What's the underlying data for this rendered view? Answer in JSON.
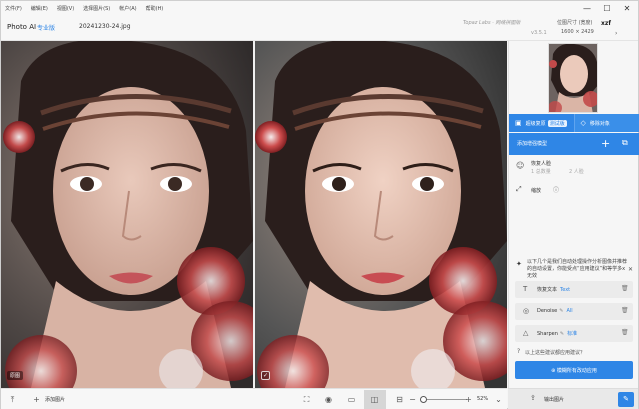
{
  "menu": [
    "文件(F)",
    "编辑(E)",
    "视图(V)",
    "选择图片(S)",
    "帐户(A)",
    "帮助(H)"
  ],
  "window_controls": {
    "minimize": "—",
    "maximize": "☐",
    "close": "✕"
  },
  "header": {
    "app_name": "Photo AI",
    "edition": "专业版",
    "file_name": "20241230-24.jpg",
    "brand": "Topaz Labs · 网络拼图版",
    "version": "v3.5.1",
    "output_size_label": "位图尺寸 (宽度)",
    "output_size": "1600 × 2429",
    "user": "xzf",
    "arrow": "›"
  },
  "preview": {
    "original_badge": "原图",
    "check_mark": "✓"
  },
  "bottombar": {
    "upload_icon": "⤒",
    "add_icon": "+",
    "add_image_label": "添加图片",
    "zoom_value": "52%",
    "zoom_chevron": "⌄",
    "crop_icon": "⛶",
    "eye_icon": "◉",
    "single_icon": "▭",
    "compare_icon": "◫",
    "split_icon": "⊟",
    "minus_icon": "−",
    "plus_icon": "+"
  },
  "panel": {
    "tabs": [
      {
        "icon": "▣",
        "label": "超级复原",
        "pill": "测试版"
      },
      {
        "icon": "◇",
        "label": "移除对象"
      }
    ],
    "add_model": {
      "label": "添加增强模型",
      "plus": "+",
      "crop": "⧉"
    },
    "face": {
      "icon": "☺",
      "title": "恢复人脸",
      "count": "1 总数量",
      "count2": "2 人脸"
    },
    "resize": {
      "icon": "⤢",
      "label": "缩放",
      "info": "ⓘ"
    },
    "autopilot": {
      "icon": "✦",
      "text": "以下几个是我们自动处理操作分析图像并推荐的自动设置，你能受点“应用建议”和等学多x无效",
      "close": "✕"
    },
    "suggestions": [
      {
        "icon": "T",
        "name": "恢复文本",
        "tag": "Text",
        "edit": ""
      },
      {
        "icon": "◎",
        "name": "Denoise",
        "edit": "✎",
        "tag": "All"
      },
      {
        "icon": "△",
        "name": "Sharpen",
        "edit": "✎",
        "tag": "标准"
      }
    ],
    "trash_icon": "🗑",
    "question": {
      "icon": "?",
      "text": "以上这些建议都应用建议？"
    },
    "apply_button": "⊕ 模糊所有改动应用"
  },
  "export": {
    "icon": "⇪",
    "label": "输出图片",
    "button_icon": "✎"
  },
  "colors": {
    "accent": "#2f86e6",
    "panel_bg": "#f6f6f6",
    "toolbar_bg": "#f7f7f7"
  }
}
